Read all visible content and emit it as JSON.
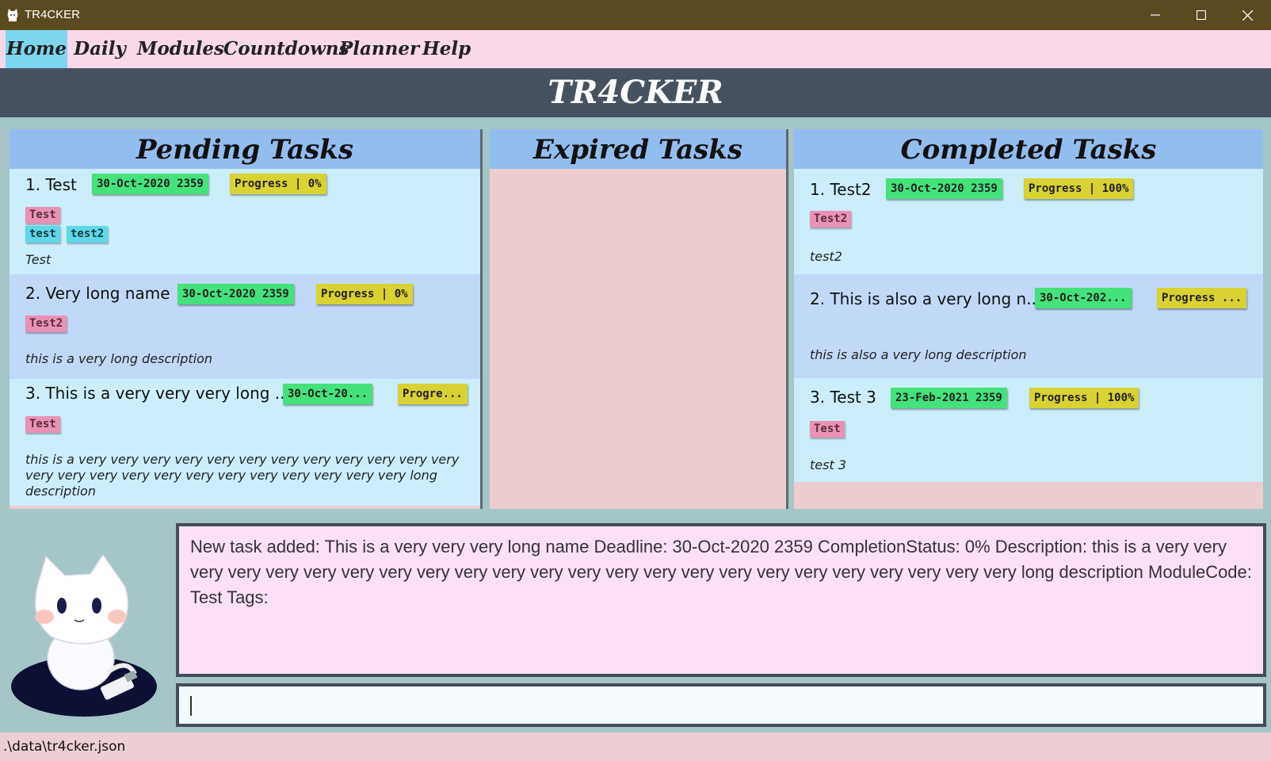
{
  "window": {
    "title": "TR4CKER"
  },
  "menu": [
    "Home",
    "Daily",
    "Modules",
    "Countdowns",
    "Planner",
    "Help"
  ],
  "banner": "TR4CKER",
  "panels": {
    "pending": {
      "title": "Pending Tasks",
      "tasks": [
        {
          "name": "1.  Test",
          "date": "30-Oct-2020 2359",
          "progress": "Progress | 0%",
          "module": "Test",
          "tags": [
            "test",
            "test2"
          ],
          "desc": "Test"
        },
        {
          "name": "2.  Very long name",
          "date": "30-Oct-2020 2359",
          "progress": "Progress | 0%",
          "module": "Test2",
          "desc": "this is a very long description"
        },
        {
          "name": "3.  This is a very very very long ...",
          "date": "30-Oct-20...",
          "progress": "Progre...",
          "module": "Test",
          "desc": "this is a very very very very very very very very very very very very very very very very very very very very very very very very  long description"
        }
      ]
    },
    "expired": {
      "title": "Expired Tasks"
    },
    "completed": {
      "title": "Completed Tasks",
      "tasks": [
        {
          "name": "1.  Test2",
          "date": "30-Oct-2020 2359",
          "progress": "Progress | 100%",
          "module": "Test2",
          "desc": "test2"
        },
        {
          "name": "2.  This is also a very long n...",
          "date": "30-Oct-202...",
          "progress": "Progress ...",
          "desc": "this is also a very long description"
        },
        {
          "name": "3.  Test 3",
          "date": "23-Feb-2021 2359",
          "progress": "Progress | 100%",
          "module": "Test",
          "desc": "test 3"
        }
      ]
    }
  },
  "result_text": "New task added: This is a very very very long name Deadline: 30-Oct-2020 2359 CompletionStatus: 0% Description: this is a very very very very very very very very very very very very very very very very very very very very very very very very  long description ModuleCode: Test Tags:",
  "command_input": "",
  "status_path": ".\\data\\tr4cker.json",
  "colors": {
    "titlebar": "#5a4a1f",
    "menubar": "#f7d9ea",
    "active_tab": "#7ed6ee",
    "banner": "#475260",
    "panel_header": "#92bdef",
    "date_chip": "#44e27a",
    "progress_chip": "#d8d233",
    "module_tag": "#ea92b6",
    "label_tag": "#5ed8ea"
  },
  "icons": [
    "cat-icon",
    "minimize-icon",
    "maximize-icon",
    "close-icon",
    "cat-mascot"
  ]
}
